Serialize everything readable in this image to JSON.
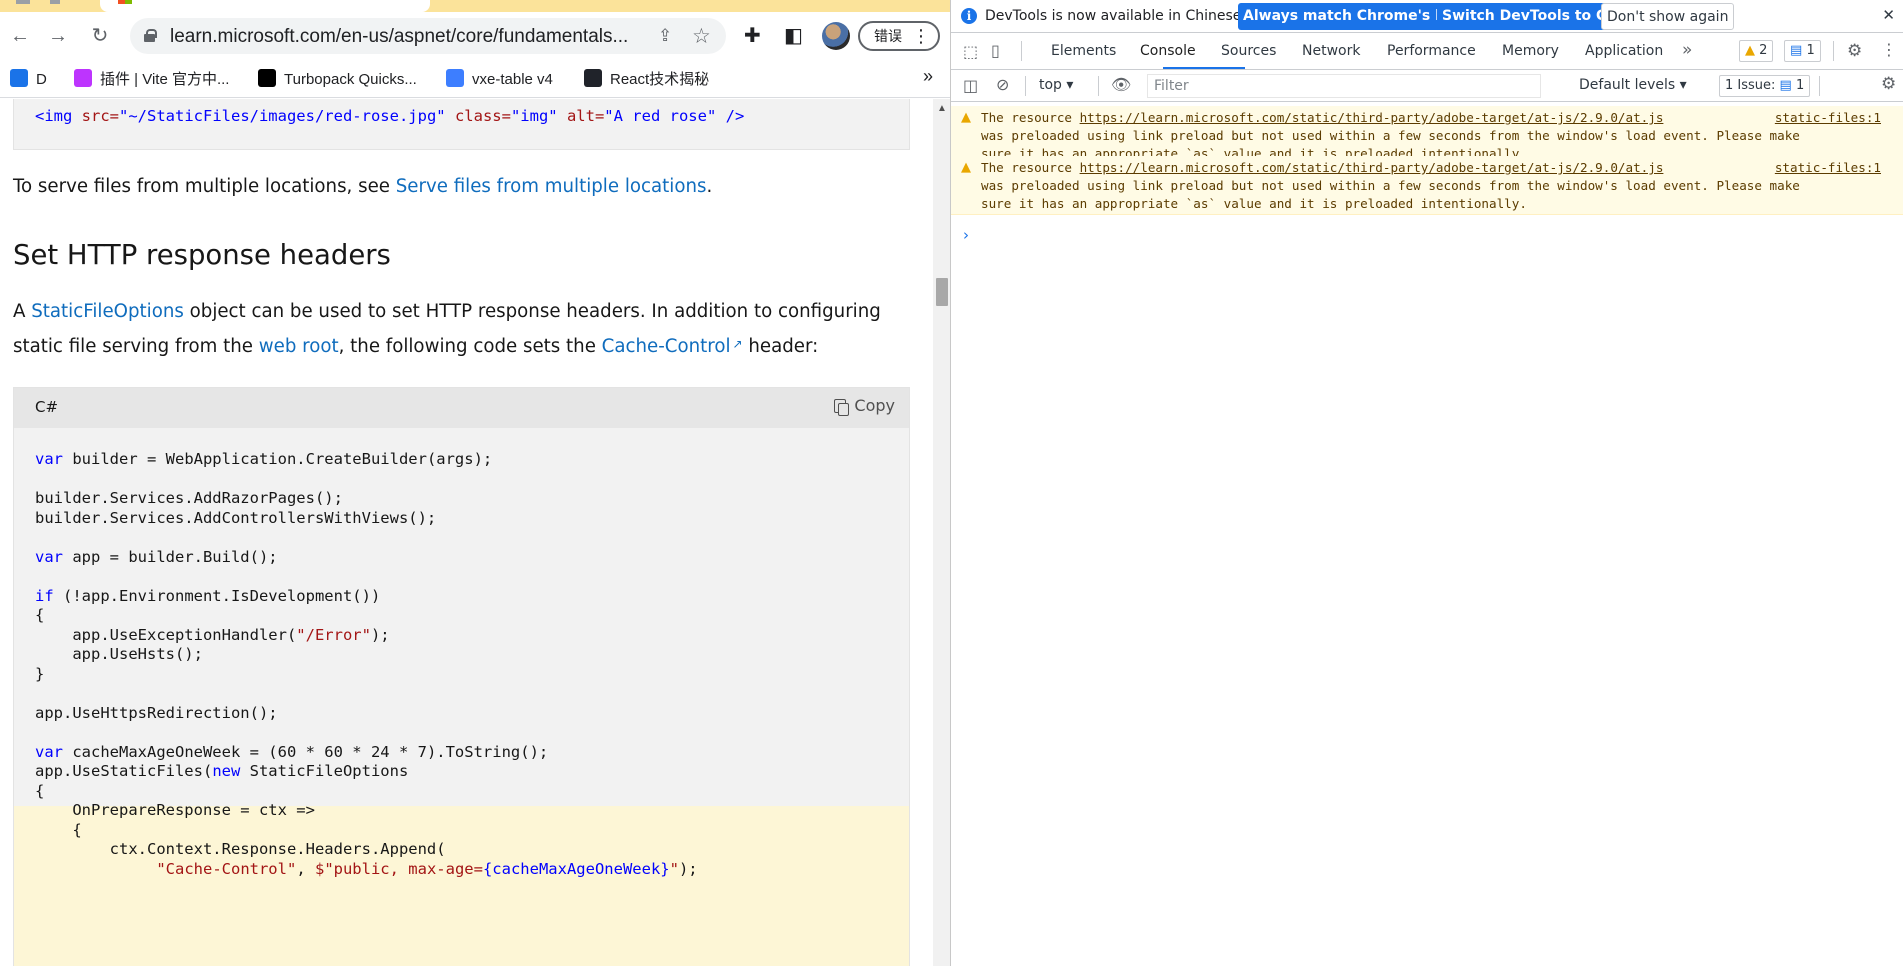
{
  "browser": {
    "url": "learn.microsoft.com/en-us/aspnet/core/fundamentals...",
    "error_button_label": "错误",
    "bookmarks": [
      {
        "label": "D",
        "color": "#1a73e8"
      },
      {
        "label": "插件 | Vite 官方中...",
        "color": "#bd34fe"
      },
      {
        "label": "Turbopack Quicks...",
        "color": "#000000"
      },
      {
        "label": "vxe-table v4",
        "color": "#3d7eff"
      },
      {
        "label": "React技术揭秘",
        "color": "#20232a"
      }
    ]
  },
  "doc": {
    "top_code": {
      "tag_open": "<img",
      "src_attr": " src=",
      "src_val": "\"~/StaticFiles/images/red-rose.jpg\"",
      "class_attr": " class=",
      "class_val": "\"img\"",
      "alt_attr": " alt=",
      "alt_val": "\"A red rose\"",
      "tag_close": " />"
    },
    "para1_prefix": "To serve files from multiple locations, see ",
    "para1_link": "Serve files from multiple locations",
    "para1_suffix": ".",
    "heading": "Set HTTP response headers",
    "para2_a": "A ",
    "para2_link1": "StaticFileOptions",
    "para2_b": " object can be used to set HTTP response headers. In addition to configuring static file serving from the ",
    "para2_link2": "web root",
    "para2_c": ", the following code sets the ",
    "para2_link3": "Cache-Control",
    "para2_d": " header:",
    "code_lang": "C#",
    "copy_label": "Copy"
  },
  "code_lines": [
    [
      {
        "t": "var",
        "c": "kw"
      },
      {
        "t": " builder = WebApplication.CreateBuilder(args);"
      }
    ],
    [],
    [
      {
        "t": "builder.Services.AddRazorPages();"
      }
    ],
    [
      {
        "t": "builder.Services.AddControllersWithViews();"
      }
    ],
    [],
    [
      {
        "t": "var",
        "c": "kw"
      },
      {
        "t": " app = builder.Build();"
      }
    ],
    [],
    [
      {
        "t": "if",
        "c": "kw"
      },
      {
        "t": " (!app.Environment.IsDevelopment())"
      }
    ],
    [
      {
        "t": "{"
      }
    ],
    [
      {
        "t": "    app.UseExceptionHandler("
      },
      {
        "t": "\"/Error\"",
        "c": "str"
      },
      {
        "t": ");"
      }
    ],
    [
      {
        "t": "    app.UseHsts();"
      }
    ],
    [
      {
        "t": "}"
      }
    ],
    [],
    [
      {
        "t": "app.UseHttpsRedirection();"
      }
    ],
    [],
    [
      {
        "t": "var",
        "c": "kw"
      },
      {
        "t": " cacheMaxAgeOneWeek = (60 * 60 * 24 * 7).ToString();"
      }
    ],
    [
      {
        "t": "app.UseStaticFiles("
      },
      {
        "t": "new",
        "c": "kw"
      },
      {
        "t": " StaticFileOptions"
      }
    ],
    [
      {
        "t": "{"
      }
    ],
    [
      {
        "t": "    OnPrepareResponse = ctx =>"
      }
    ],
    [
      {
        "t": "    {"
      }
    ],
    [
      {
        "t": "        ctx.Context.Response.Headers.Append("
      }
    ],
    [
      {
        "t": "             "
      },
      {
        "t": "\"Cache-Control\"",
        "c": "str"
      },
      {
        "t": ", "
      },
      {
        "t": "$\"public, max-age=",
        "c": "str"
      },
      {
        "t": "{cacheMaxAgeOneWeek}",
        "c": "kw"
      },
      {
        "t": "\"",
        "c": "str"
      },
      {
        "t": ");"
      }
    ]
  ],
  "devtools": {
    "info_message": "DevTools is now available in Chinese!",
    "btn_match": "Always match Chrome's language",
    "btn_switch": "Switch DevTools to Chinese",
    "btn_dismiss": "Don't show again",
    "tabs": [
      "Elements",
      "Console",
      "Sources",
      "Network",
      "Performance",
      "Memory",
      "Application"
    ],
    "active_tab": "Console",
    "warning_count": "2",
    "message_count": "1",
    "context": "top",
    "filter_placeholder": "Filter",
    "levels": "Default levels",
    "issues": "1 Issue:",
    "issues_count": "1",
    "messages": [
      {
        "prefix": "The resource ",
        "resource": "https://learn.microsoft.com/static/third-party/adobe-target/at-js/2.9.0/at.js",
        "body": "was preloaded using link preload but not used within a few seconds from the window's load event. Please make sure it has an appropriate `as` value and it is preloaded intentionally.",
        "source": "static-files:1"
      },
      {
        "prefix": "The resource ",
        "resource": "https://learn.microsoft.com/static/third-party/adobe-target/at-js/2.9.0/at.js",
        "body": "was preloaded using link preload but not used within a few seconds from the window's load event. Please make sure it has an appropriate `as` value and it is preloaded intentionally.",
        "source": "static-files:1"
      }
    ]
  },
  "colors": {
    "link": "#0f6cbd",
    "keyword": "#0101fd",
    "string": "#a31515",
    "highlight": "#fdf6d6",
    "devtools_accent": "#1a73e8",
    "warning_bg": "#fffbe5"
  }
}
